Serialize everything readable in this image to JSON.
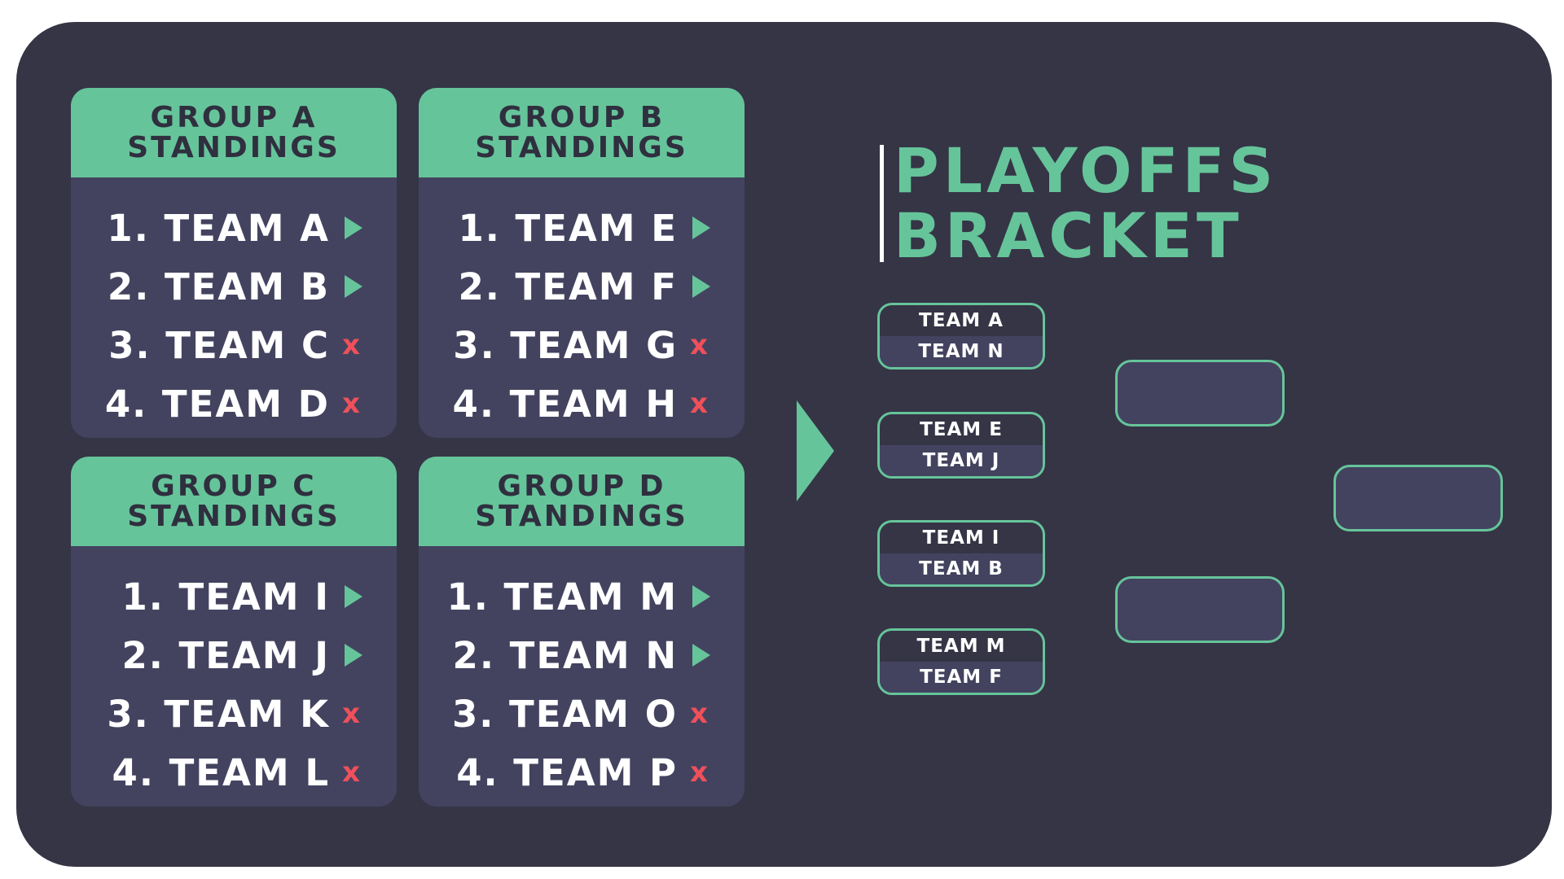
{
  "groups": [
    {
      "header_line1": "Group A",
      "header_line2": "Standings",
      "standings": [
        {
          "text": "1. Team A",
          "status": "qualified"
        },
        {
          "text": "2. Team B",
          "status": "qualified"
        },
        {
          "text": "3. Team C",
          "status": "eliminated"
        },
        {
          "text": "4. Team D",
          "status": "eliminated"
        }
      ]
    },
    {
      "header_line1": "Group B",
      "header_line2": "Standings",
      "standings": [
        {
          "text": "1. Team E",
          "status": "qualified"
        },
        {
          "text": "2. Team F",
          "status": "qualified"
        },
        {
          "text": "3. Team G",
          "status": "eliminated"
        },
        {
          "text": "4. Team H",
          "status": "eliminated"
        }
      ]
    },
    {
      "header_line1": "Group C",
      "header_line2": "Standings",
      "standings": [
        {
          "text": "1. Team I",
          "status": "qualified"
        },
        {
          "text": "2. Team J",
          "status": "qualified"
        },
        {
          "text": "3. Team K",
          "status": "eliminated"
        },
        {
          "text": "4. Team L",
          "status": "eliminated"
        }
      ]
    },
    {
      "header_line1": "Group D",
      "header_line2": "Standings",
      "standings": [
        {
          "text": "1. Team M",
          "status": "qualified"
        },
        {
          "text": "2. Team N",
          "status": "qualified"
        },
        {
          "text": "3. Team O",
          "status": "eliminated"
        },
        {
          "text": "4. Team P",
          "status": "eliminated"
        }
      ]
    }
  ],
  "bracket": {
    "title_line1": "Playoffs",
    "title_line2": "Bracket",
    "quarterfinals": [
      {
        "top": "Team A",
        "bottom": "Team N"
      },
      {
        "top": "Team E",
        "bottom": "Team J"
      },
      {
        "top": "Team I",
        "bottom": "Team B"
      },
      {
        "top": "Team M",
        "bottom": "Team F"
      }
    ]
  },
  "icons": {
    "qualified": "triangle-right-icon",
    "eliminated_glyph": "x",
    "arrow": "triangle-right-icon"
  },
  "colors": {
    "background": "#353546",
    "panel": "#434360",
    "accent": "#66c49a",
    "eliminated": "#f0505a",
    "text": "#ffffff"
  }
}
